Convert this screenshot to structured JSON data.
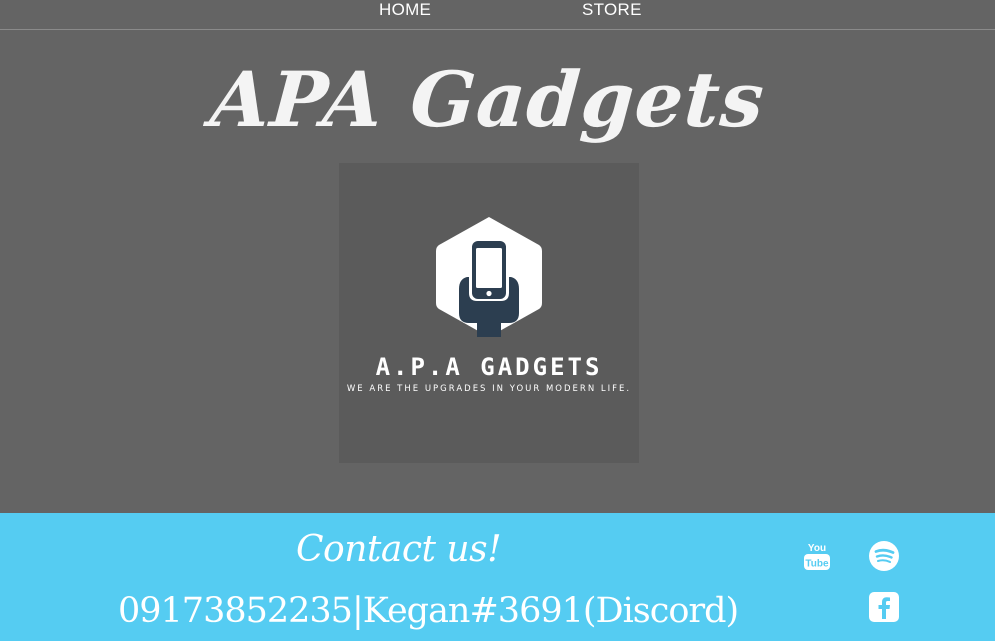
{
  "nav": {
    "home": "HOME",
    "store": "STORE"
  },
  "header": {
    "title": "APA Gadgets"
  },
  "logo": {
    "icon": "phone-in-hand-hexagon-icon",
    "name": "A.P.A GADGETS",
    "tagline": "WE ARE THE UPGRADES IN YOUR MODERN LIFE."
  },
  "footer": {
    "heading": "Contact us!",
    "info": "09173852235|Kegan#3691(Discord)",
    "social": [
      "youtube-icon",
      "spotify-icon",
      "facebook-icon"
    ]
  },
  "colors": {
    "background": "#646464",
    "logo_box": "#5b5b5b",
    "footer": "#55ccf2",
    "logo_dark": "#2c3e50"
  }
}
